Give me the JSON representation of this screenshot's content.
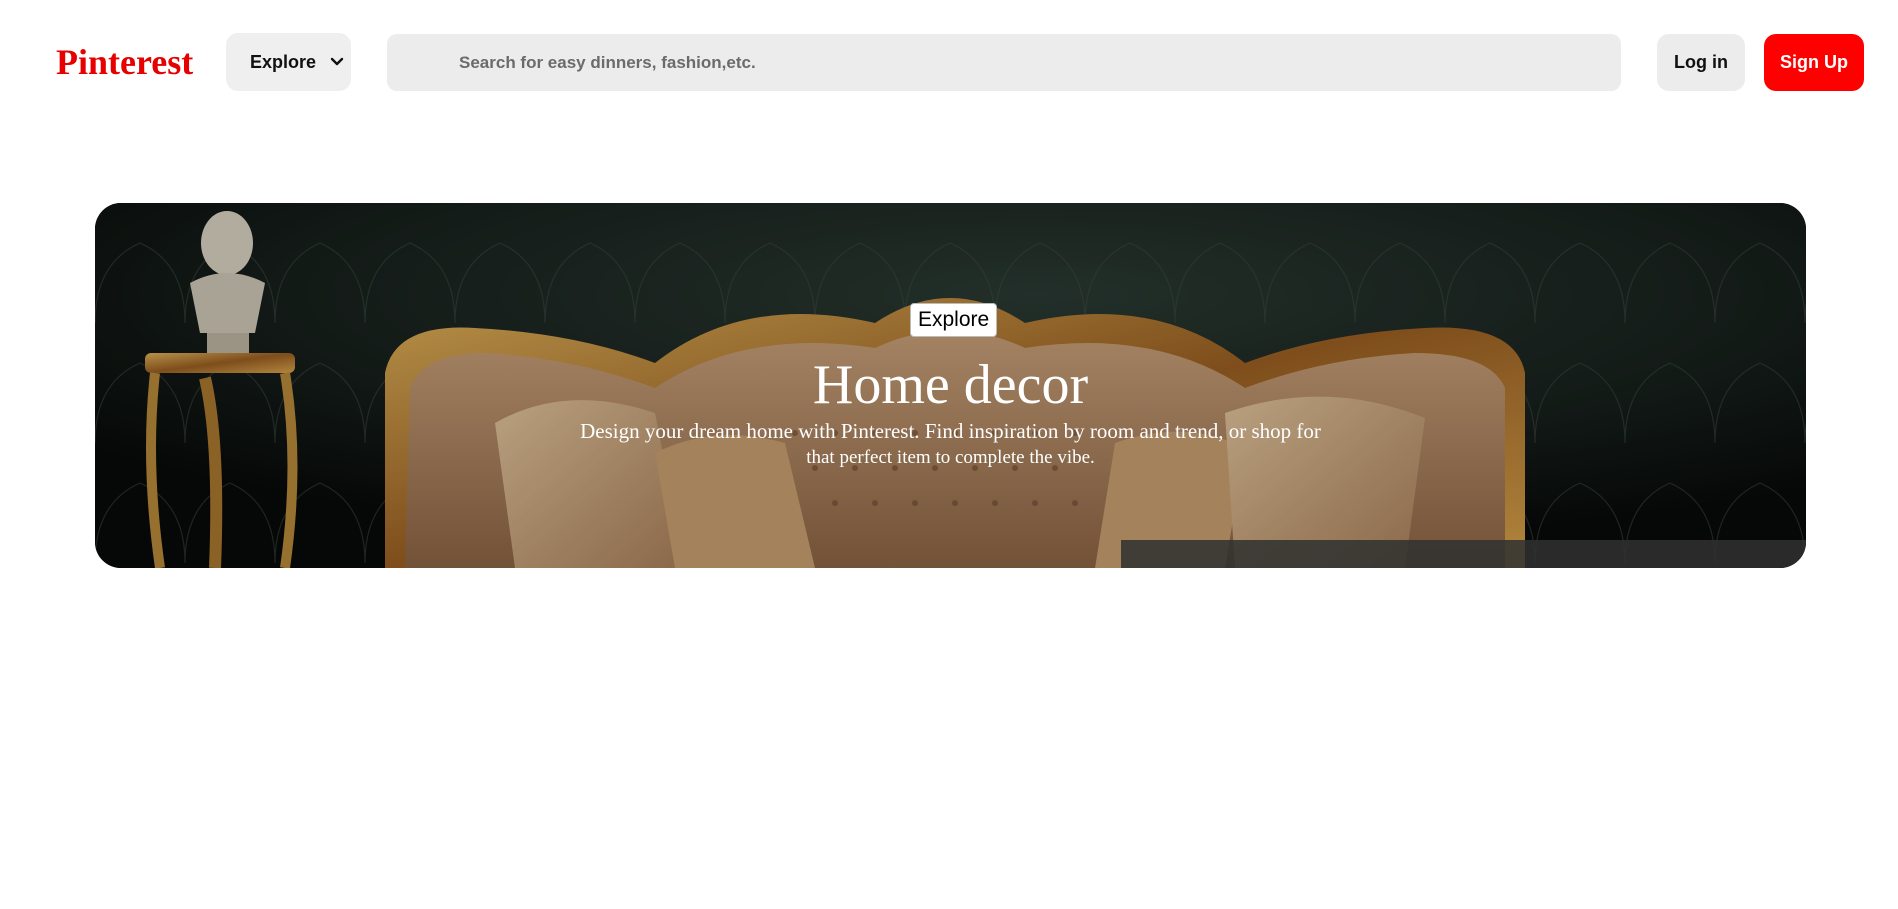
{
  "header": {
    "logo": "Pinterest",
    "explore_select": {
      "selected": "Explore",
      "options": [
        "Explore"
      ]
    },
    "search": {
      "placeholder": "Search for easy dinners, fashion,etc.",
      "value": ""
    },
    "login_label": "Log in",
    "signup_label": "Sign Up"
  },
  "hero": {
    "explore_label": "Explore",
    "title": "Home decor",
    "description_line1": "Design your dream home with Pinterest. Find inspiration by room and trend, or shop for",
    "description_line2": "that perfect item to complete the vibe."
  },
  "colors": {
    "brand": "#e60000",
    "signup_bg": "#ff0000",
    "button_bg": "#ececec"
  },
  "icons": {
    "select_chevron": "chevron-down-icon"
  }
}
